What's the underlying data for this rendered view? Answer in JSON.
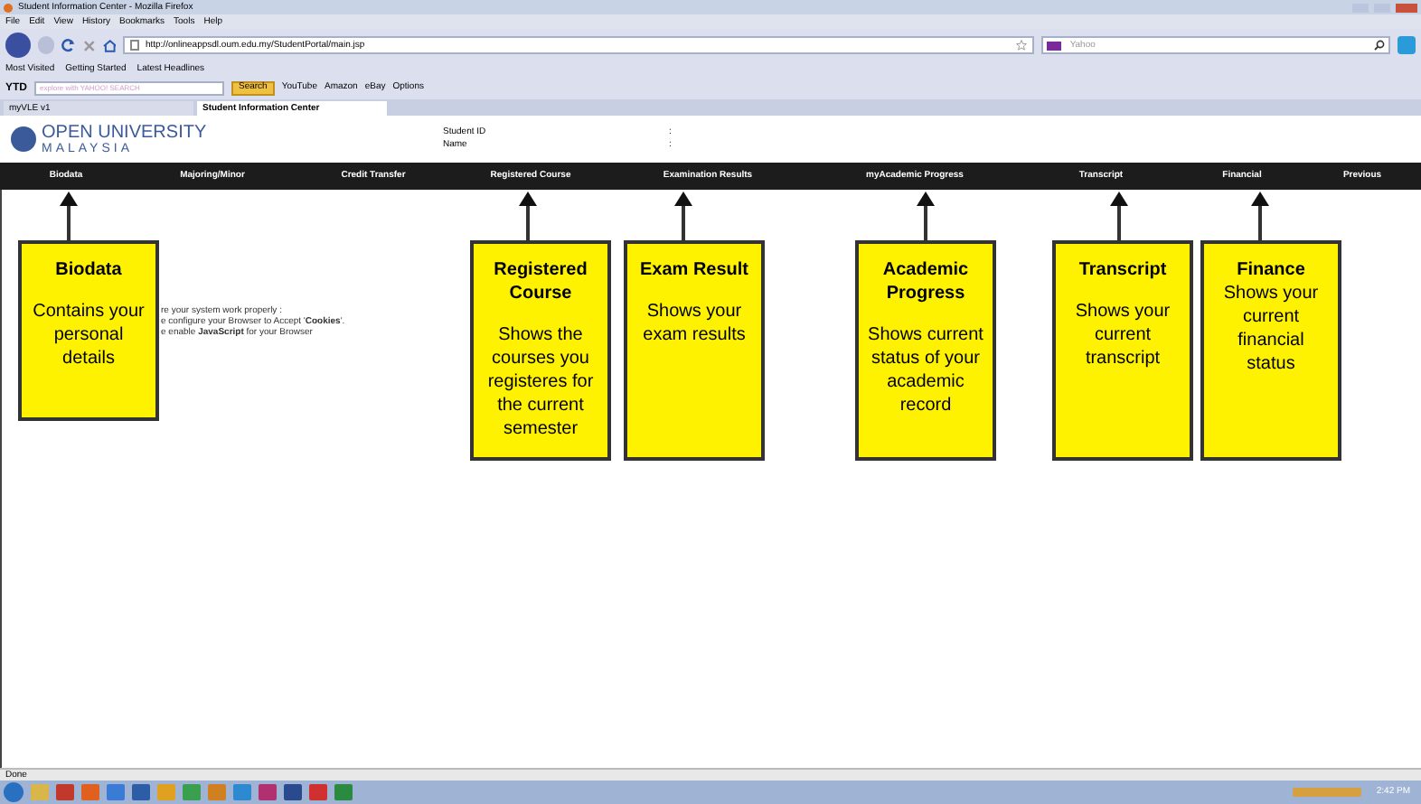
{
  "window": {
    "title": "Student Information Center - Mozilla Firefox"
  },
  "menu": [
    "File",
    "Edit",
    "View",
    "History",
    "Bookmarks",
    "Tools",
    "Help"
  ],
  "address": {
    "value": "http://onlineappsdl.oum.edu.my/StudentPortal/main.jsp"
  },
  "search": {
    "placeholder": "Yahoo"
  },
  "bookmarks": [
    "Most Visited",
    "Getting Started",
    "Latest Headlines"
  ],
  "toolbar": {
    "label": "YTD",
    "search_placeholder": "explore with YAHOO! SEARCH",
    "search_button": "Search",
    "links": [
      "YouTube",
      "Amazon",
      "eBay",
      "Options"
    ]
  },
  "tabs": [
    {
      "label": "myVLE v1",
      "selected": false
    },
    {
      "label": "Student Information Center",
      "selected": true
    }
  ],
  "page": {
    "logo_top": "OPEN UNIVERSITY",
    "logo_bottom": "MALAYSIA",
    "fields": [
      {
        "label": "Student ID",
        "separator": ":"
      },
      {
        "label": "Name",
        "separator": ":"
      }
    ],
    "nav": [
      "Biodata",
      "Majoring/Minor",
      "Credit Transfer",
      "Registered Course",
      "Examination Results",
      "myAcademic Progress",
      "Transcript",
      "Financial",
      "Previous"
    ],
    "notice": [
      "re your system work properly :",
      "e configure your Browser to Accept '**Cookies**'.",
      "e enable **JavaScript** for your Browser"
    ]
  },
  "callouts": [
    {
      "title": "Biodata",
      "body": "Contains your personal details"
    },
    {
      "title": "Registered Course",
      "body": "Shows the courses you registeres for the current semester"
    },
    {
      "title": "Exam Result",
      "body": "Shows your exam results"
    },
    {
      "title": "Academic Progress",
      "body": "Shows current status of your academic record"
    },
    {
      "title": "Transcript",
      "body": "Shows your current transcript"
    },
    {
      "title": "Finance",
      "body": "Shows your current financial status"
    }
  ],
  "status_bar": {
    "text": "Done"
  },
  "taskbar": {
    "clock": "2:42 PM"
  }
}
